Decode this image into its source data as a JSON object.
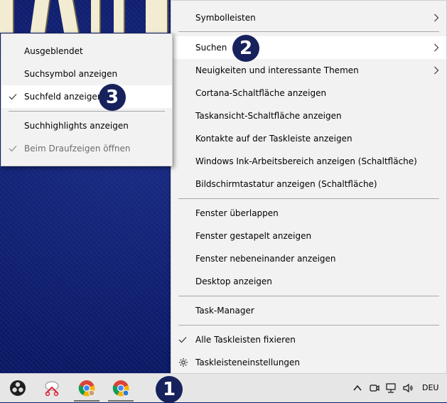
{
  "main_menu": {
    "items": [
      {
        "label": "Symbolleisten"
      },
      {
        "label": "Suchen"
      },
      {
        "label": "Neuigkeiten und interessante Themen"
      },
      {
        "label": "Cortana-Schaltfläche anzeigen"
      },
      {
        "label": "Taskansicht-Schaltfläche anzeigen"
      },
      {
        "label": "Kontakte auf der Taskleiste anzeigen"
      },
      {
        "label": "Windows Ink-Arbeitsbereich anzeigen (Schaltfläche)"
      },
      {
        "label": "Bildschirmtastatur anzeigen (Schaltfläche)"
      },
      {
        "label": "Fenster überlappen"
      },
      {
        "label": "Fenster gestapelt anzeigen"
      },
      {
        "label": "Fenster nebeneinander anzeigen"
      },
      {
        "label": "Desktop anzeigen"
      },
      {
        "label": "Task-Manager"
      },
      {
        "label": "Alle Taskleisten fixieren"
      },
      {
        "label": "Taskleisteneinstellungen"
      }
    ]
  },
  "sub_menu": {
    "items": [
      {
        "label": "Ausgeblendet"
      },
      {
        "label": "Suchsymbol anzeigen"
      },
      {
        "label": "Suchfeld anzeigen"
      },
      {
        "label": "Suchhighlights anzeigen"
      },
      {
        "label": "Beim Draufzeigen öffnen"
      }
    ]
  },
  "badges": {
    "one": "1",
    "two": "2",
    "three": "3"
  },
  "taskbar": {
    "apps": [
      "obs-icon",
      "snipping-tool-icon",
      "chrome-profile-icon",
      "chrome-alt-profile-icon"
    ],
    "tray": {
      "language": "DEU"
    }
  },
  "colors": {
    "desktop": "#0b1a6a",
    "menu_bg": "#f2f2f2",
    "hover_bg": "#ffffff",
    "badge_bg": "#17215c",
    "taskbar_bg": "#e6e6e6"
  }
}
